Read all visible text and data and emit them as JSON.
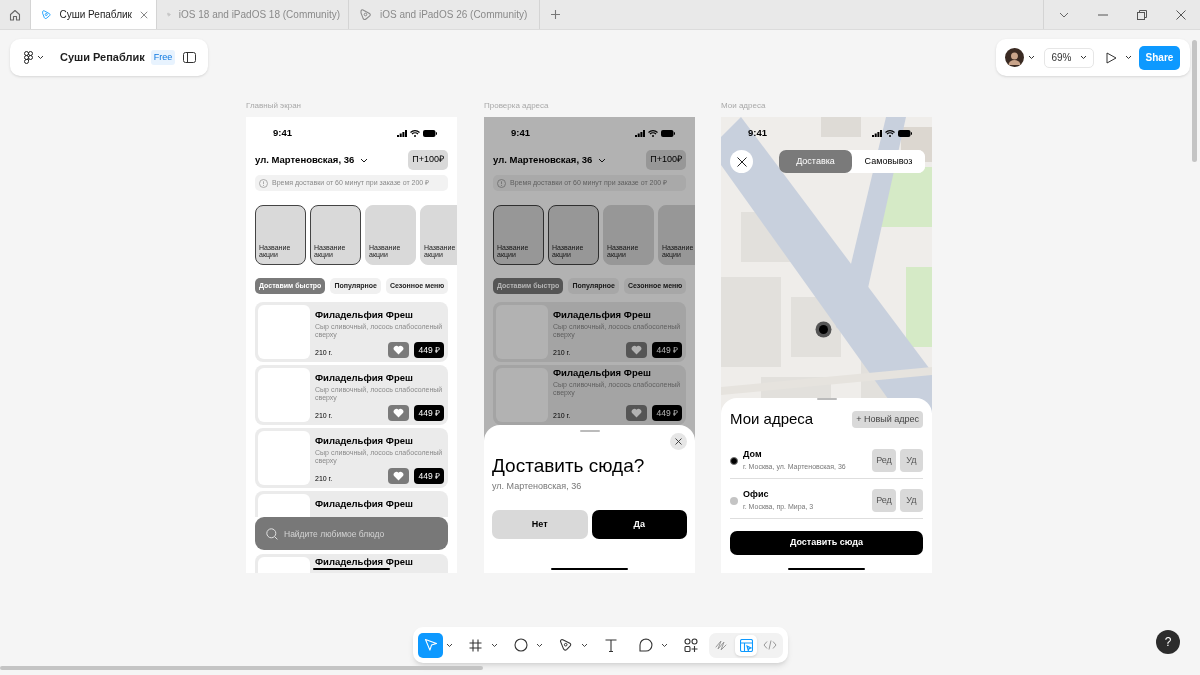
{
  "browser_tabs": [
    {
      "label": "Суши Репаблик",
      "selected": true
    },
    {
      "label": "iOS 18 and iPadOS 18 (Community)",
      "selected": false
    },
    {
      "label": "iOS and iPadOS 26 (Community)",
      "selected": false
    }
  ],
  "file_bar": {
    "title": "Суши Репаблик",
    "plan_badge": "Free"
  },
  "share_bar": {
    "zoom": "69%",
    "share_button": "Share"
  },
  "frames": [
    {
      "label": "Главный экран",
      "kind": "home",
      "dimmed": false,
      "status_time": "9:41",
      "address": "ул. Мартеновская, 36",
      "bonus": "П+100₽",
      "notice": "Время доставки от 60 минут при заказе от 200 ₽",
      "promos": [
        {
          "title": "Название акции",
          "outlined": true
        },
        {
          "title": "Название акции",
          "outlined": true
        },
        {
          "title": "Название акции",
          "outlined": false
        },
        {
          "title": "Название акции",
          "outlined": false
        }
      ],
      "chips": [
        {
          "label": "Доставим быстро",
          "selected": true
        },
        {
          "label": "Популярное",
          "selected": false
        },
        {
          "label": "Сезонное меню",
          "selected": false
        }
      ],
      "products": [
        {
          "title": "Филадельфия Фреш",
          "description": "Сыр сливочный, лосось слабосоленый сверху",
          "weight": "210 г.",
          "price": "449 ₽"
        },
        {
          "title": "Филадельфия Фреш",
          "description": "Сыр сливочный, лосось слабосоленый сверху",
          "weight": "210 г.",
          "price": "449 ₽"
        },
        {
          "title": "Филадельфия Фреш",
          "description": "Сыр сливочный, лосось слабосоленый сверху",
          "weight": "210 г.",
          "price": "449 ₽"
        },
        {
          "title": "Филадельфия Фреш"
        },
        {
          "title": "Филадельфия Фреш"
        }
      ],
      "search": {
        "placeholder": "Найдите любимое блюдо"
      }
    },
    {
      "label": "Проверка адреса",
      "kind": "address_check",
      "dimmed": true,
      "status_time": "9:41",
      "address": "ул. Мартеновская, 36",
      "bonus": "П+100₽",
      "notice": "Время доставки от 60 минут при заказе от 200 ₽",
      "promos": [
        {
          "title": "Название акции",
          "outlined": true
        },
        {
          "title": "Название акции",
          "outlined": true
        },
        {
          "title": "Название акции",
          "outlined": false
        },
        {
          "title": "Название акции",
          "outlined": false
        }
      ],
      "chips": [
        {
          "label": "Доставим быстро",
          "selected": true
        },
        {
          "label": "Популярное",
          "selected": false
        },
        {
          "label": "Сезонное меню",
          "selected": false
        }
      ],
      "products": [
        {
          "title": "Филадельфия Фреш",
          "description": "Сыр сливочный, лосось слабосоленый сверху",
          "weight": "210 г.",
          "price": "449 ₽"
        },
        {
          "title": "Филадельфия Фреш",
          "description": "Сыр сливочный, лосось слабосоленый сверху",
          "weight": "210 г.",
          "price": "449 ₽"
        }
      ],
      "sheet": {
        "title": "Доставить сюда?",
        "address": "ул. Мартеновская, 36",
        "buttons": [
          {
            "label": "Нет",
            "kind": "secondary"
          },
          {
            "label": "Да",
            "kind": "primary"
          }
        ]
      }
    },
    {
      "label": "Мои адреса",
      "kind": "addresses",
      "status_time": "9:41",
      "map": {
        "kind": "picture"
      },
      "delivery_modes": [
        {
          "label": "Доставка",
          "selected": true
        },
        {
          "label": "Самовывоз",
          "selected": false
        }
      ],
      "sheet": {
        "title": "Мои адреса",
        "new_button": "+ Новый адрес",
        "addresses": [
          {
            "name": "Дом",
            "address": "г. Москва, ул. Мартеновская, 36",
            "selected": true,
            "edit": "Ред",
            "delete": "Уд"
          },
          {
            "name": "Офис",
            "address": "г. Москва, пр. Мира, 3",
            "selected": false,
            "edit": "Ред",
            "delete": "Уд"
          }
        ],
        "submit": "Доставить сюда"
      }
    }
  ],
  "tools": [
    {
      "kind": "move",
      "selected": true,
      "menu": true
    },
    {
      "kind": "frame",
      "selected": false,
      "menu": true
    },
    {
      "kind": "ellipse",
      "selected": false,
      "menu": true
    },
    {
      "kind": "pen",
      "selected": false,
      "menu": true
    },
    {
      "kind": "text",
      "selected": false,
      "menu": false
    },
    {
      "kind": "comment",
      "selected": false,
      "menu": true
    },
    {
      "kind": "actions",
      "selected": false,
      "menu": false
    }
  ],
  "modes": [
    {
      "kind": "draw",
      "selected": false
    },
    {
      "kind": "design",
      "selected": true
    },
    {
      "kind": "dev",
      "selected": false
    }
  ],
  "help_button": "?"
}
